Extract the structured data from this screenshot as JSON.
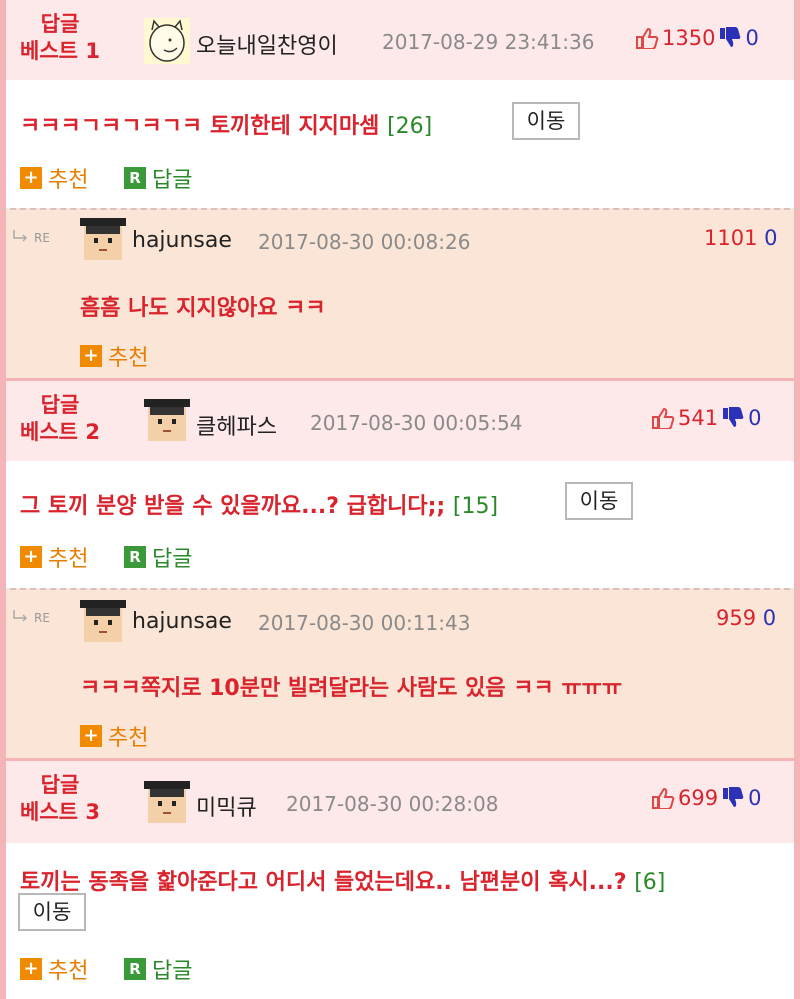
{
  "icons": {
    "thumb_up": "thumbs-up-icon",
    "thumb_down": "thumbs-down-icon",
    "plus": "plus-icon",
    "reply_r": "reply-r-icon",
    "re": "re-arrow-icon"
  },
  "colors": {
    "accent_red": "#d9232d",
    "down_blue": "#2b32b8",
    "count_green": "#2a8a2a",
    "recommend_orange": "#e67e00",
    "best_bg": "#fde8ea",
    "reply_bg": "#fbe5d6"
  },
  "labels": {
    "recommend": "추천",
    "reply": "답글",
    "move": "이동",
    "re": "RE",
    "plus": "+",
    "r": "R"
  },
  "best1": {
    "rank_line1": "답글",
    "rank_line2": "베스트 1",
    "nick": "오늘내일찬영이",
    "date": "2017-08-29 23:41:36",
    "up": "1350",
    "down": "0",
    "content": "ㅋㅋㅋㄱㅋㄱㅋㄱㅋ 토끼한테 지지마셈",
    "count": "[26]"
  },
  "reply1": {
    "nick": "hajunsae",
    "date": "2017-08-30 00:08:26",
    "up": "1101",
    "down": "0",
    "content": "흠흠 나도 지지않아요 ㅋㅋ"
  },
  "best2": {
    "rank_line1": "답글",
    "rank_line2": "베스트 2",
    "nick": "클헤파스",
    "date": "2017-08-30 00:05:54",
    "up": "541",
    "down": "0",
    "content": "그 토끼 분양 받을 수 있을까요...? 급합니다;;",
    "count": "[15]"
  },
  "reply2": {
    "nick": "hajunsae",
    "date": "2017-08-30 00:11:43",
    "up": "959",
    "down": "0",
    "content": "ㅋㅋㅋ쪽지로 10분만 빌려달라는 사람도 있음 ㅋㅋ ㅠㅠㅠ"
  },
  "best3": {
    "rank_line1": "답글",
    "rank_line2": "베스트 3",
    "nick": "미믹큐",
    "date": "2017-08-30 00:28:08",
    "up": "699",
    "down": "0",
    "content": "토끼는 동족을 핥아준다고 어디서 들었는데요.. 남편분이 혹시...?",
    "count": "[6]"
  }
}
